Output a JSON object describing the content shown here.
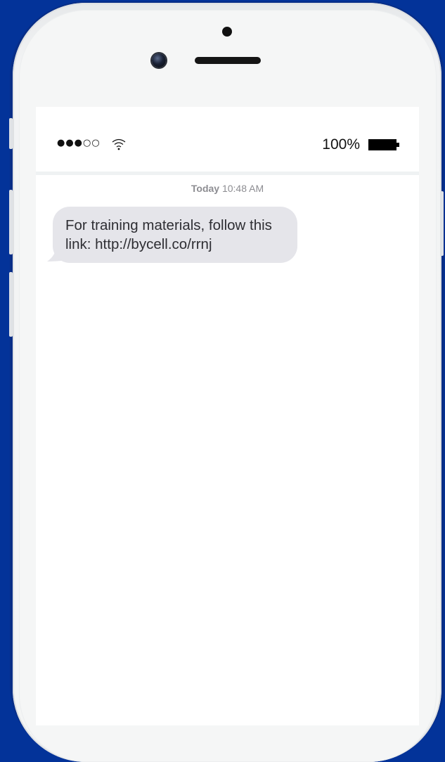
{
  "status_bar": {
    "signal_filled": "●●●",
    "signal_empty": "○○",
    "wifi_icon": "wifi-icon",
    "battery_percent": "100%",
    "battery_icon": "battery-full-icon"
  },
  "conversation": {
    "timestamp_day": "Today",
    "timestamp_time": "10:48 AM",
    "messages": [
      {
        "direction": "incoming",
        "text": "For training materials, follow this link: http://bycell.co/rrnj"
      }
    ]
  },
  "colors": {
    "background": "#033399",
    "bubble_incoming": "#e5e5ea",
    "timestamp": "#8d8d92"
  }
}
